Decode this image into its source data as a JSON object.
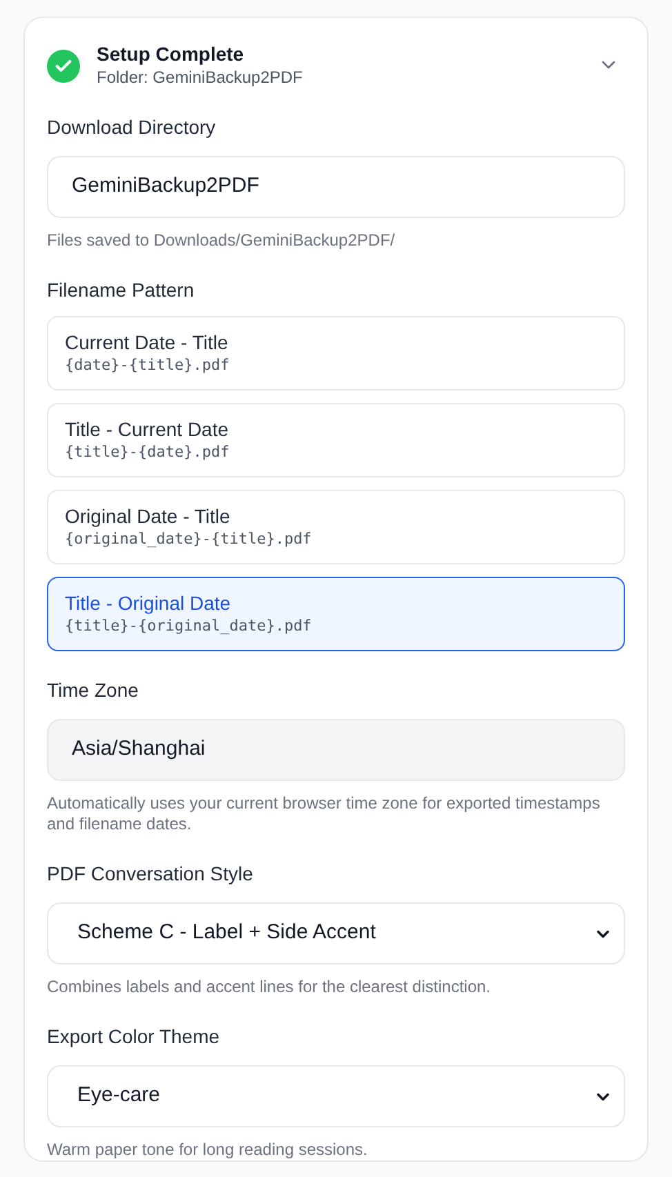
{
  "header": {
    "title": "Setup Complete",
    "subtitle": "Folder: GeminiBackup2PDF",
    "expanded": true
  },
  "download_directory": {
    "label": "Download Directory",
    "value": "GeminiBackup2PDF",
    "help": "Files saved to Downloads/GeminiBackup2PDF/"
  },
  "filename_pattern": {
    "label": "Filename Pattern",
    "options": [
      {
        "title": "Current Date - Title",
        "pattern": "{date}-{title}.pdf",
        "selected": false
      },
      {
        "title": "Title - Current Date",
        "pattern": "{title}-{date}.pdf",
        "selected": false
      },
      {
        "title": "Original Date - Title",
        "pattern": "{original_date}-{title}.pdf",
        "selected": false
      },
      {
        "title": "Title - Original Date",
        "pattern": "{title}-{original_date}.pdf",
        "selected": true
      }
    ]
  },
  "time_zone": {
    "label": "Time Zone",
    "value": "Asia/Shanghai",
    "help": "Automatically uses your current browser time zone for exported timestamps and filename dates."
  },
  "conversation_style": {
    "label": "PDF Conversation Style",
    "value": "Scheme C - Label + Side Accent",
    "help": "Combines labels and accent lines for the clearest distinction."
  },
  "color_theme": {
    "label": "Export Color Theme",
    "value": "Eye-care",
    "help": "Warm paper tone for long reading sessions."
  }
}
